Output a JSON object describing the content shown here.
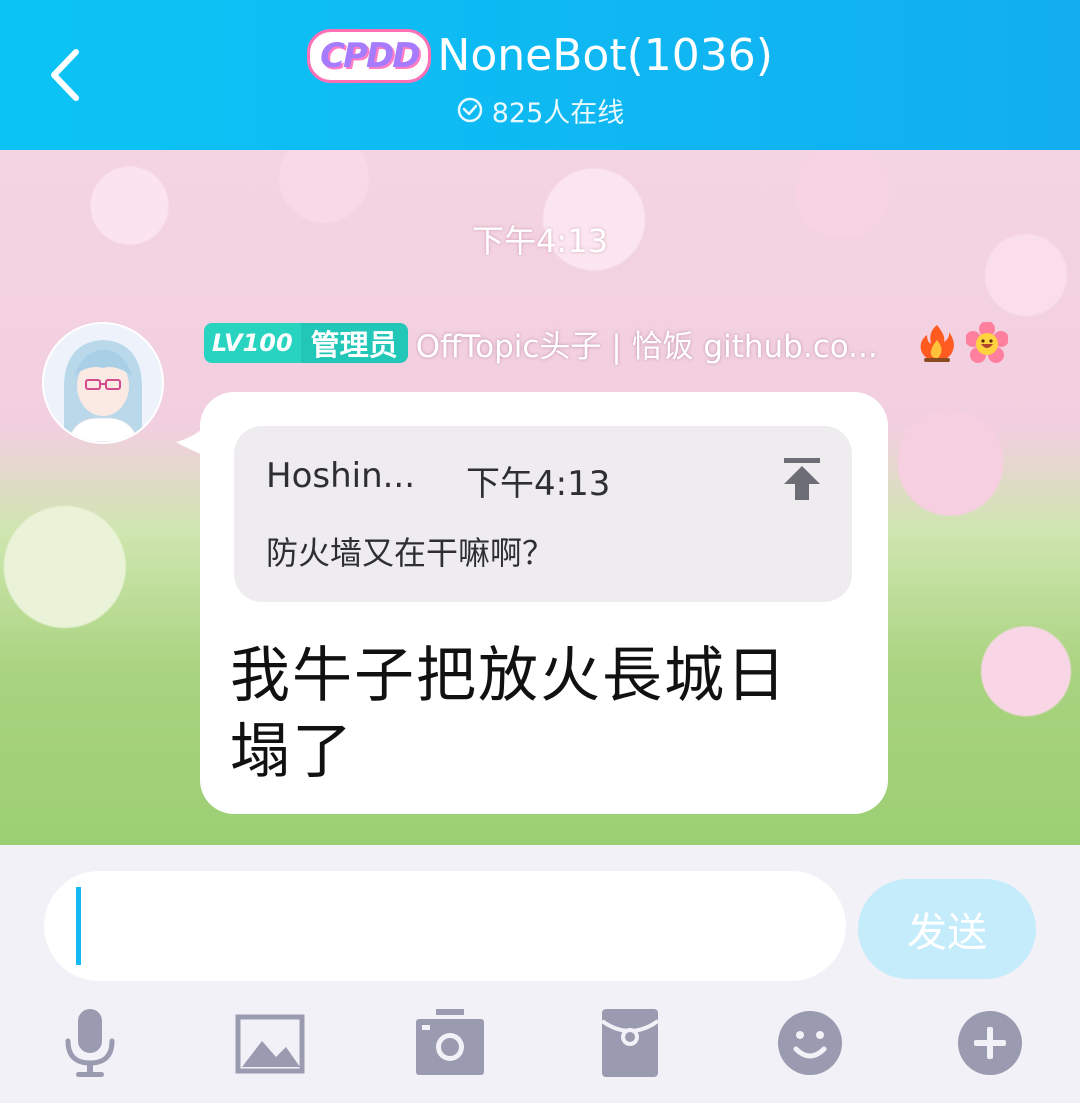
{
  "header": {
    "back_icon": "chevron-left-icon",
    "brand_badge": "CPDD",
    "group_title": "NoneBot(1036)",
    "online_status": "825人在线",
    "online_icon": "check-circle-icon"
  },
  "chat": {
    "time_label": "下午4:13",
    "message": {
      "level_badge": "LV100",
      "role_badge": "管理员",
      "sender_name": "OffTopic头子 | 恰饭 github.co...",
      "emoji_icons": [
        "fire-emoji-icon",
        "smiley-flower-emoji-icon"
      ],
      "quote": {
        "sender": "Hoshin...",
        "time": "下午4:13",
        "text": "防火墙又在干嘛啊？",
        "jump_icon": "jump-to-top-icon"
      },
      "text": "我牛子把放火長城日塌了"
    }
  },
  "composer": {
    "input_value": "",
    "send_label": "发送"
  },
  "toolbar": {
    "icons": [
      "microphone-icon",
      "image-icon",
      "camera-icon",
      "red-packet-icon",
      "emoji-icon",
      "plus-icon"
    ]
  },
  "colors": {
    "header_bg": "#0bc4f5",
    "accent": "#14b8f2",
    "admin_badge": "#22c7b8",
    "send_button": "#c5ecfb",
    "toolbar_icon": "#9a9bb0"
  }
}
